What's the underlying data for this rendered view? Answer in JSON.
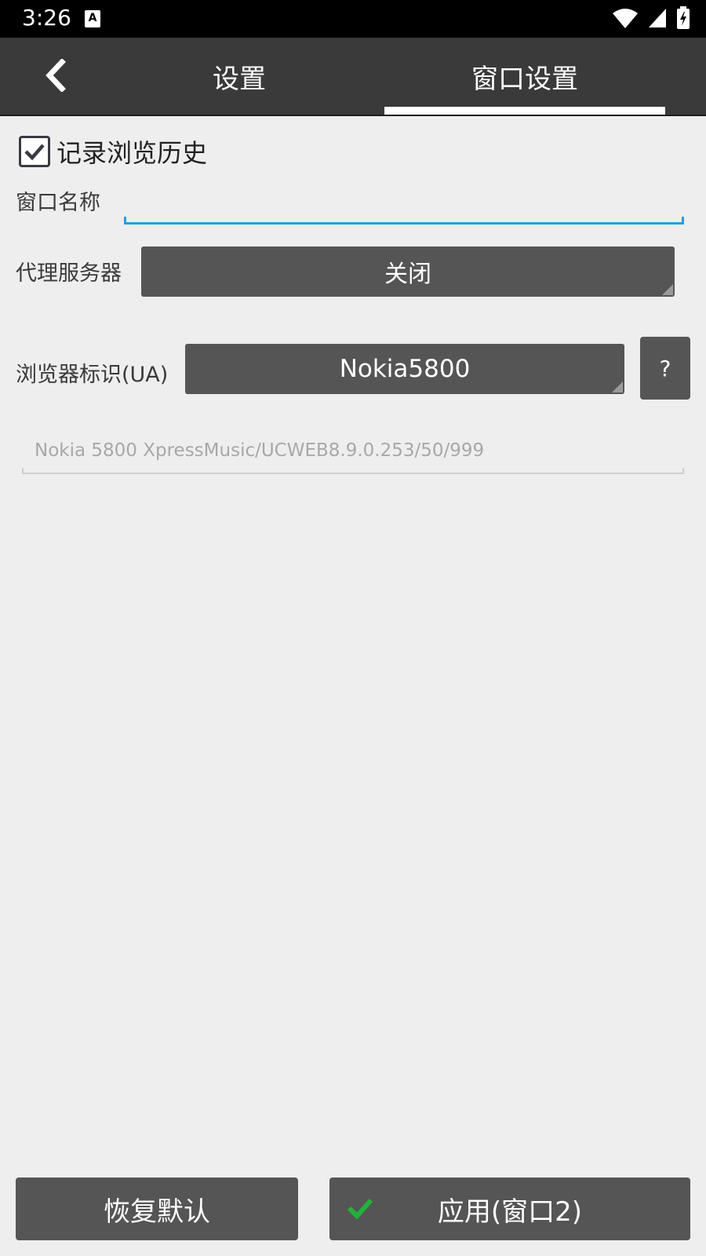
{
  "status_bar": {
    "time": "3:26",
    "notification_icon": "a-icon",
    "icons": [
      "wifi-icon",
      "signal-icon",
      "battery-charging-icon"
    ]
  },
  "topbar": {
    "back_icon": "chevron-left-icon",
    "tabs": [
      {
        "label": "设置",
        "selected": false
      },
      {
        "label": "窗口设置",
        "selected": true
      }
    ]
  },
  "form": {
    "record_history": {
      "label": "记录浏览历史",
      "checked": true
    },
    "window_name": {
      "label": "窗口名称",
      "value": ""
    },
    "proxy": {
      "label": "代理服务器",
      "selected": "关闭"
    },
    "user_agent": {
      "label": "浏览器标识(UA)",
      "selected": "Nokia5800",
      "help_label": "?",
      "string_placeholder": "Nokia 5800 XpressMusic/UCWEB8.9.0.253/50/999"
    }
  },
  "footer": {
    "restore_label": "恢复默认",
    "apply_label": "应用(窗口2)",
    "apply_icon": "check-icon"
  },
  "colors": {
    "topbar_bg": "#3a3a3a",
    "button_bg": "#555555",
    "accent_input": "#2a9fd6",
    "check_green": "#22b33a",
    "page_bg": "#eeeeee"
  }
}
